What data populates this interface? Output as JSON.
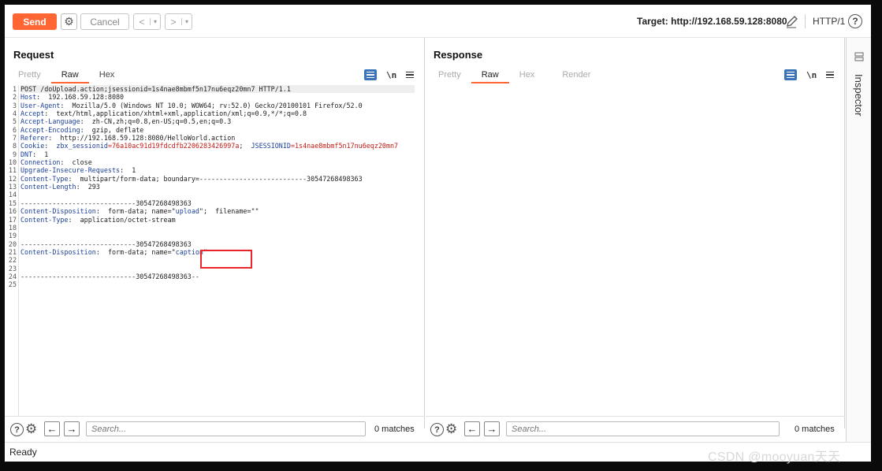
{
  "toolbar": {
    "send_label": "Send",
    "cancel_label": "Cancel",
    "back_glyph": "<",
    "forward_glyph": ">",
    "dropdown_glyph": "▾",
    "target_label": "Target: http://192.168.59.128:8080",
    "protocol_label": "HTTP/1",
    "help_glyph": "?",
    "icons": [
      "gear-icon",
      "edit-icon",
      "help-icon"
    ]
  },
  "request": {
    "title": "Request",
    "tabs": [
      {
        "label": "Pretty",
        "active": false
      },
      {
        "label": "Raw",
        "active": true
      },
      {
        "label": "Hex",
        "active": false
      }
    ],
    "newline_toggle": "\\n",
    "lines": [
      {
        "n": "1",
        "parts": [
          {
            "t": "POST /doUpload.action;jsessionid=1s4nae8mbmf5n17nu6eqz20mn7 HTTP/1.1",
            "c": "plain"
          }
        ]
      },
      {
        "n": "2",
        "parts": [
          {
            "t": "Host",
            "c": "k"
          },
          {
            "t": ":  192.168.59.128:8080",
            "c": "plain"
          }
        ]
      },
      {
        "n": "3",
        "parts": [
          {
            "t": "User-Agent",
            "c": "k"
          },
          {
            "t": ":  Mozilla/5.0 (Windows NT 10.0; WOW64; rv:52.0) Gecko/20100101 Firefox/52.0",
            "c": "plain"
          }
        ]
      },
      {
        "n": "4",
        "parts": [
          {
            "t": "Accept",
            "c": "k"
          },
          {
            "t": ":  text/html,application/xhtml+xml,application/xml;q=0.9,*/*;q=0.8",
            "c": "plain"
          }
        ]
      },
      {
        "n": "5",
        "parts": [
          {
            "t": "Accept-Language",
            "c": "k"
          },
          {
            "t": ":  zh-CN,zh;q=0.8,en-US;q=0.5,en;q=0.3",
            "c": "plain"
          }
        ]
      },
      {
        "n": "6",
        "parts": [
          {
            "t": "Accept-Encoding",
            "c": "k"
          },
          {
            "t": ":  gzip, deflate",
            "c": "plain"
          }
        ]
      },
      {
        "n": "7",
        "parts": [
          {
            "t": "Referer",
            "c": "k"
          },
          {
            "t": ":  http://192.168.59.128:8080/HelloWorld.action",
            "c": "plain"
          }
        ]
      },
      {
        "n": "8",
        "parts": [
          {
            "t": "Cookie",
            "c": "k"
          },
          {
            "t": ":  ",
            "c": "plain"
          },
          {
            "t": "zbx_sessionid",
            "c": "k"
          },
          {
            "t": "=76a10ac91d19fdcdfb2206283426997a",
            "c": "r"
          },
          {
            "t": ";  ",
            "c": "plain"
          },
          {
            "t": "JSESSIONID",
            "c": "k"
          },
          {
            "t": "=1s4nae8mbmf5n17nu6eqz20mn7",
            "c": "r"
          }
        ]
      },
      {
        "n": "9",
        "parts": [
          {
            "t": "DNT",
            "c": "k"
          },
          {
            "t": ":  1",
            "c": "plain"
          }
        ]
      },
      {
        "n": "10",
        "parts": [
          {
            "t": "Connection",
            "c": "k"
          },
          {
            "t": ":  close",
            "c": "plain"
          }
        ]
      },
      {
        "n": "11",
        "parts": [
          {
            "t": "Upgrade-Insecure-Requests",
            "c": "k"
          },
          {
            "t": ":  1",
            "c": "plain"
          }
        ]
      },
      {
        "n": "12",
        "parts": [
          {
            "t": "Content-Type",
            "c": "k"
          },
          {
            "t": ":  multipart/form-data; boundary=---------------------------30547268498363",
            "c": "plain"
          }
        ]
      },
      {
        "n": "13",
        "parts": [
          {
            "t": "Content-Length",
            "c": "k"
          },
          {
            "t": ":  293",
            "c": "plain"
          }
        ]
      },
      {
        "n": "14",
        "parts": [
          {
            "t": "",
            "c": "plain"
          }
        ]
      },
      {
        "n": "15",
        "parts": [
          {
            "t": "-----------------------------30547268498363",
            "c": "plain"
          }
        ]
      },
      {
        "n": "16",
        "parts": [
          {
            "t": "Content-Disposition",
            "c": "k"
          },
          {
            "t": ":  form-data; name=\"",
            "c": "plain"
          },
          {
            "t": "upload",
            "c": "s"
          },
          {
            "t": "\";  filename=\"\"",
            "c": "plain"
          }
        ]
      },
      {
        "n": "17",
        "parts": [
          {
            "t": "Content-Type",
            "c": "k"
          },
          {
            "t": ":  application/octet-stream",
            "c": "plain"
          }
        ]
      },
      {
        "n": "18",
        "parts": [
          {
            "t": "",
            "c": "plain"
          }
        ]
      },
      {
        "n": "19",
        "parts": [
          {
            "t": "",
            "c": "plain"
          }
        ]
      },
      {
        "n": "20",
        "parts": [
          {
            "t": "-----------------------------30547268498363",
            "c": "plain"
          }
        ]
      },
      {
        "n": "21",
        "parts": [
          {
            "t": "Content-Disposition",
            "c": "k"
          },
          {
            "t": ":  form-data; name=\"",
            "c": "plain"
          },
          {
            "t": "caption",
            "c": "s"
          },
          {
            "t": "\"",
            "c": "plain"
          }
        ]
      },
      {
        "n": "22",
        "parts": [
          {
            "t": "",
            "c": "plain"
          }
        ]
      },
      {
        "n": "23",
        "parts": [
          {
            "t": "",
            "c": "plain"
          }
        ]
      },
      {
        "n": "24",
        "parts": [
          {
            "t": "-----------------------------30547268498363--",
            "c": "plain"
          }
        ]
      },
      {
        "n": "25",
        "parts": [
          {
            "t": "",
            "c": "plain"
          }
        ]
      }
    ],
    "search_placeholder": "Search...",
    "matches": "0 matches"
  },
  "response": {
    "title": "Response",
    "tabs": [
      {
        "label": "Pretty",
        "active": false
      },
      {
        "label": "Raw",
        "active": true
      },
      {
        "label": "Hex",
        "active": false
      },
      {
        "label": "Render",
        "active": false
      }
    ],
    "newline_toggle": "\\n",
    "search_placeholder": "Search...",
    "matches": "0 matches"
  },
  "inspector": {
    "label": "Inspector"
  },
  "status": {
    "text": "Ready"
  },
  "watermark": "CSDN @mooyuan天天",
  "colors": {
    "accent": "#ff6633",
    "header_key": "#1b3f9a",
    "cookie_value": "#c41a16",
    "highlight_box": "#e8262b",
    "toggle_active": "#3b73b9"
  }
}
